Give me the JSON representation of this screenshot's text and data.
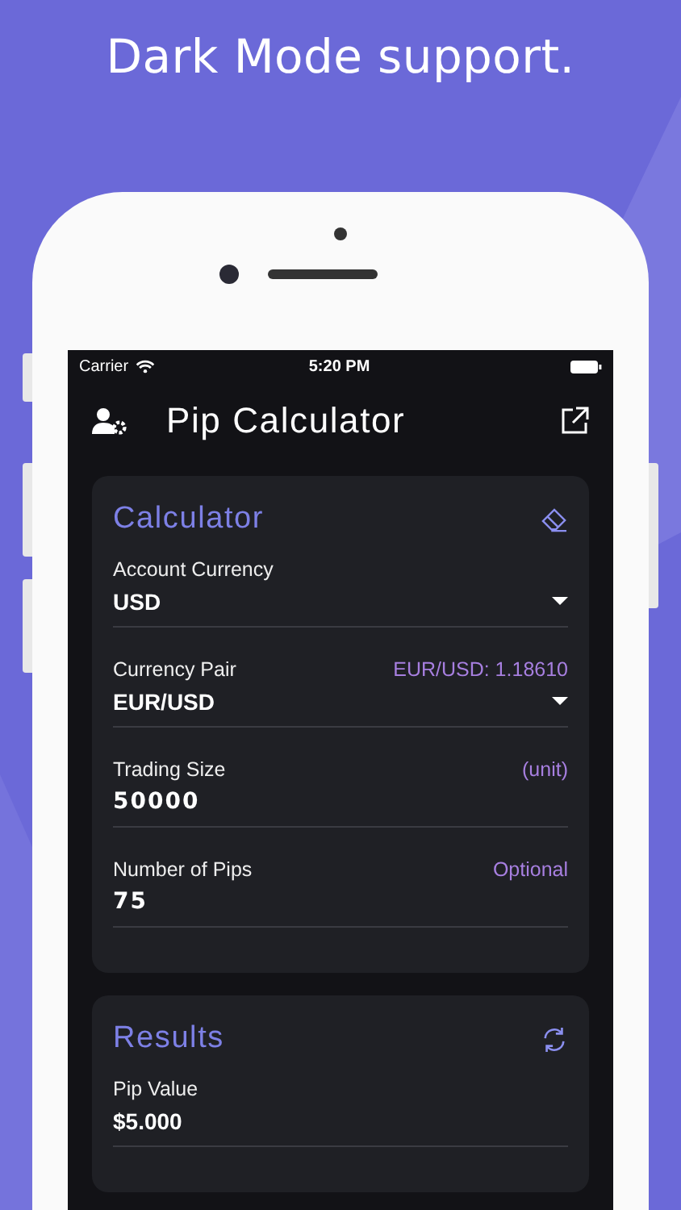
{
  "headline": "Dark Mode support.",
  "status_bar": {
    "carrier": "Carrier",
    "time": "5:20 PM"
  },
  "nav": {
    "title": "Pip Calculator"
  },
  "calculator": {
    "title": "Calculator",
    "fields": [
      {
        "kind": "dropdown",
        "label": "Account Currency",
        "value": "USD"
      },
      {
        "kind": "dropdown",
        "label": "Currency Pair",
        "hint": "EUR/USD: 1.18610",
        "value": "EUR/USD"
      },
      {
        "kind": "input",
        "label": "Trading Size",
        "hint": "(unit)",
        "value": "50000"
      },
      {
        "kind": "input",
        "label": "Number of Pips",
        "hint": "Optional",
        "value": "75"
      }
    ]
  },
  "results": {
    "title": "Results",
    "fields": [
      {
        "kind": "output",
        "label": "Pip Value",
        "value": "$5.000"
      }
    ]
  }
}
